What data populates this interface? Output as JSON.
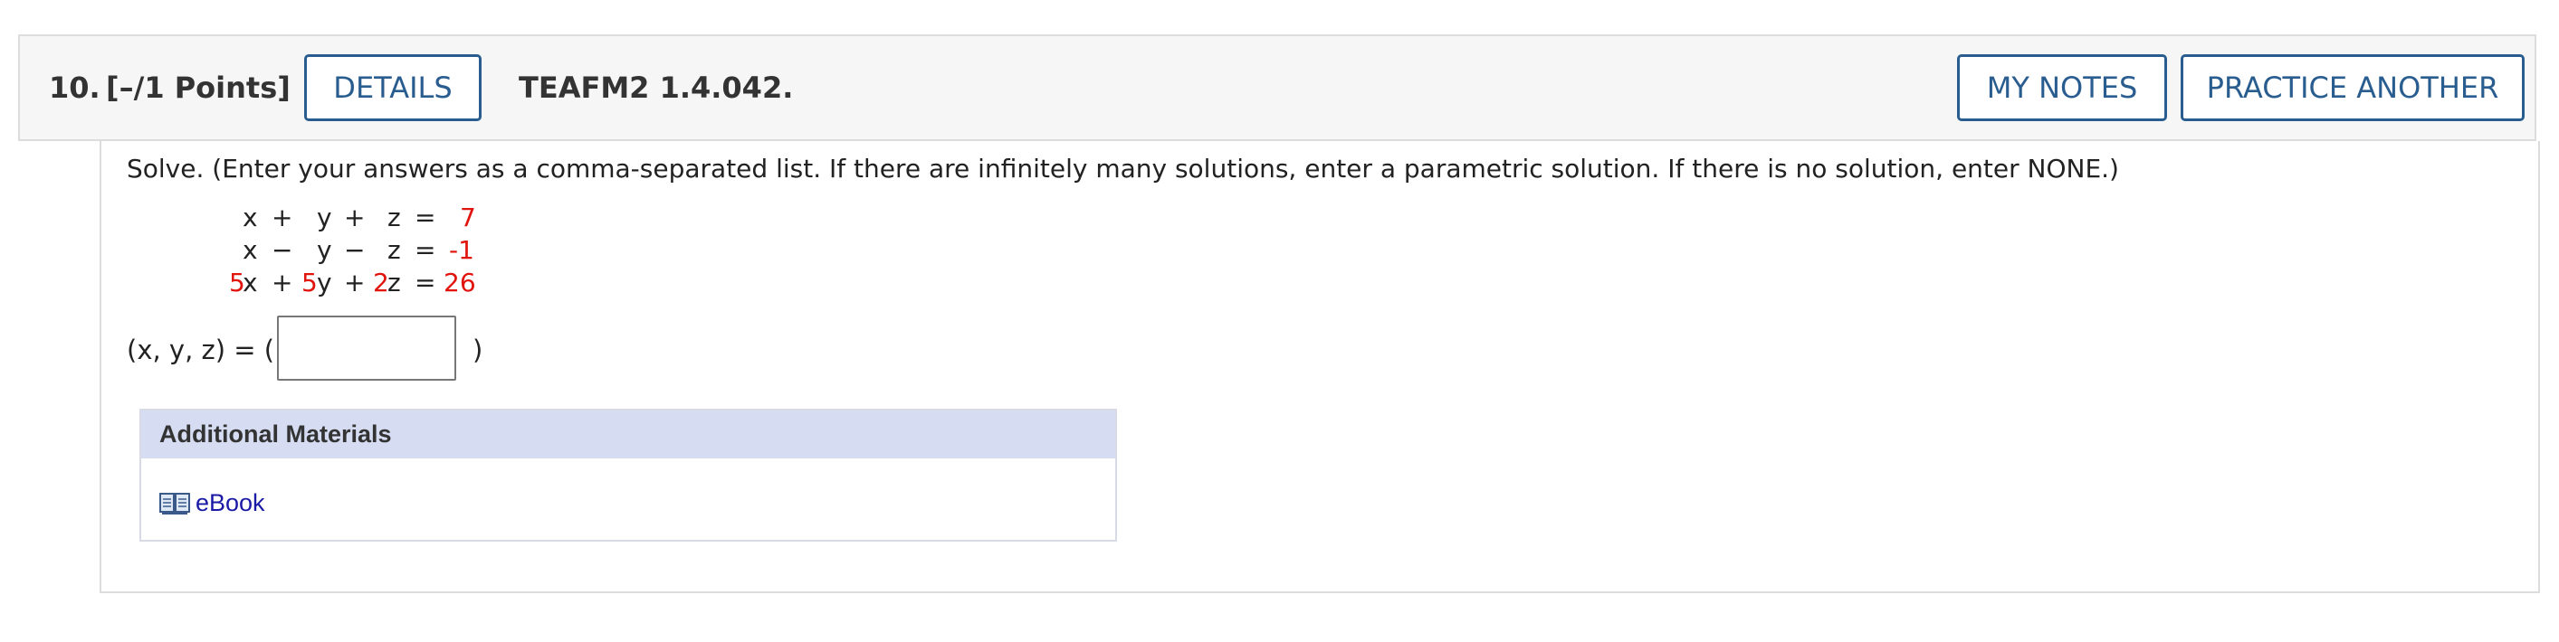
{
  "question": {
    "number": "10.",
    "points": "[–/1 Points]",
    "details_label": "DETAILS",
    "code": "TEAFM2 1.4.042.",
    "my_notes_label": "MY NOTES",
    "practice_label": "PRACTICE ANOTHER"
  },
  "instructions": "Solve. (Enter your answers as a comma-separated list. If there are infinitely many solutions, enter a parametric solution. If there is no solution, enter NONE.)",
  "system": {
    "eq1": {
      "x": "x",
      "op1": "+",
      "y": "y",
      "op2": "+",
      "z": "z",
      "eq": "=",
      "rhs": "7"
    },
    "eq2": {
      "x": "x",
      "op1": "−",
      "y": "y",
      "op2": "−",
      "z": "z",
      "eq": "=",
      "rhs": "-1"
    },
    "eq3": {
      "cx": "5",
      "x": "x",
      "op1": "+",
      "cy": "5",
      "y": "y",
      "op2": "+",
      "cz": "2",
      "z": "z",
      "eq": "=",
      "rhs": "26"
    }
  },
  "answer": {
    "label": "(x, y, z) = (",
    "close": ")",
    "value": ""
  },
  "materials": {
    "heading": "Additional Materials",
    "ebook_label": "eBook",
    "ebook_icon": "book-icon"
  },
  "colors": {
    "accent": "#2a5d8f",
    "highlight": "#e0140c",
    "materials_header": "#d6ddf3",
    "link": "#1a1aa6"
  }
}
